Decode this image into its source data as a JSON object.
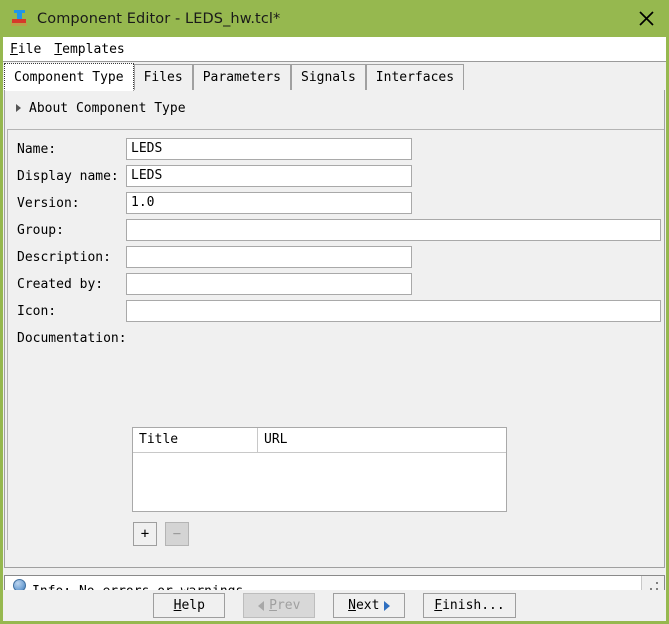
{
  "window": {
    "title": "Component Editor - LEDS_hw.tcl*",
    "icon": "component-editor-icon",
    "close_label": "✕",
    "titlebar_color": "#96b84f"
  },
  "menubar": {
    "items": [
      {
        "mnemonic": "F",
        "rest": "ile"
      },
      {
        "mnemonic": "T",
        "rest": "emplates"
      }
    ]
  },
  "tabs": [
    {
      "label": "Component Type",
      "selected": true
    },
    {
      "label": "Files",
      "selected": false
    },
    {
      "label": "Parameters",
      "selected": false
    },
    {
      "label": "Signals",
      "selected": false
    },
    {
      "label": "Interfaces",
      "selected": false
    }
  ],
  "about": {
    "label": "About Component Type",
    "expanded": false
  },
  "form": {
    "fields": [
      {
        "label": "Name:",
        "value": "LEDS",
        "width": "short"
      },
      {
        "label": "Display name:",
        "value": "LEDS",
        "width": "short"
      },
      {
        "label": "Version:",
        "value": "1.0",
        "width": "short"
      },
      {
        "label": "Group:",
        "value": "",
        "width": "wide"
      },
      {
        "label": "Description:",
        "value": "",
        "width": "short"
      },
      {
        "label": "Created by:",
        "value": "",
        "width": "short"
      },
      {
        "label": "Icon:",
        "value": "",
        "width": "wide"
      }
    ],
    "documentation": {
      "label": "Documentation:",
      "columns": [
        "Title",
        "URL"
      ],
      "rows": [],
      "add_label": "+",
      "remove_label": "−"
    }
  },
  "status": {
    "icon": "info-icon",
    "text": "Info: No errors or warnings."
  },
  "buttons": [
    {
      "mnemonic": "H",
      "rest": "elp",
      "disabled": false,
      "arrow": "none"
    },
    {
      "mnemonic": "P",
      "rest": "rev",
      "disabled": true,
      "arrow": "left"
    },
    {
      "mnemonic": "N",
      "rest": "ext",
      "disabled": false,
      "arrow": "right"
    },
    {
      "mnemonic": "F",
      "rest": "inish...",
      "disabled": false,
      "arrow": "none"
    }
  ]
}
